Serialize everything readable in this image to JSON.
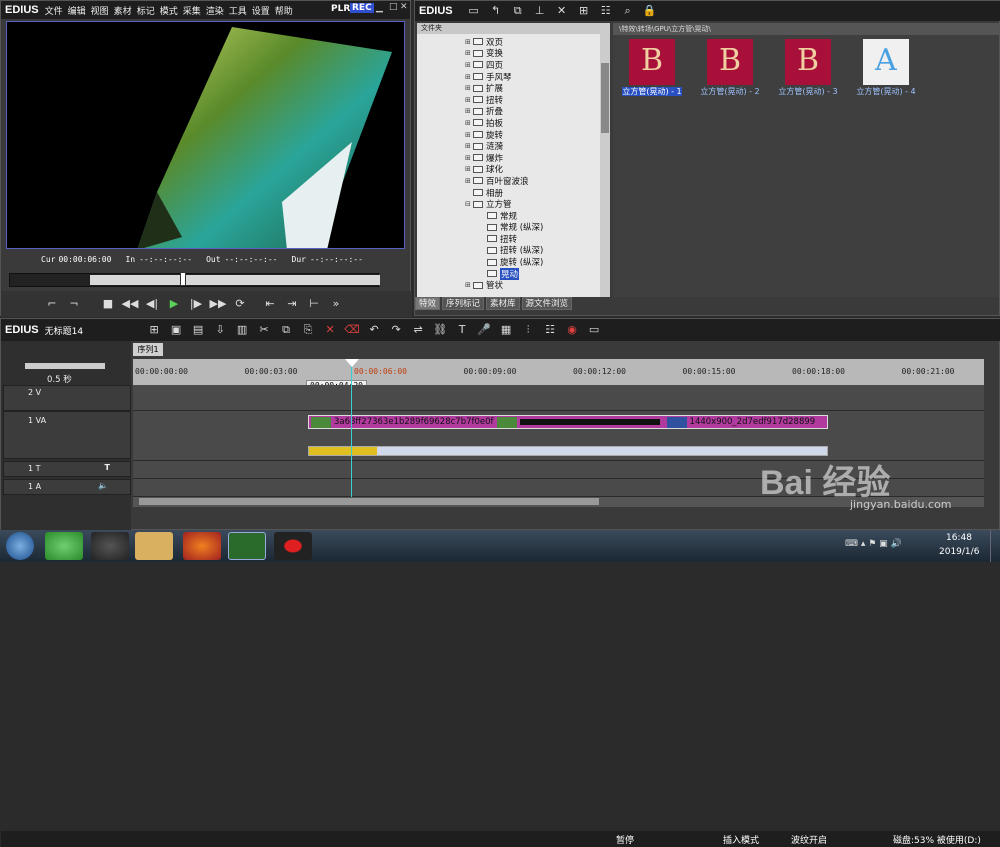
{
  "player": {
    "app_name": "EDIUS",
    "menu": [
      "文件",
      "编辑",
      "视图",
      "素材",
      "标记",
      "模式",
      "采集",
      "渲染",
      "工具",
      "设置",
      "帮助"
    ],
    "plr": "PLR",
    "rec": "REC",
    "cur_label": "Cur",
    "cur_value": "00:00:06:00",
    "in_label": "In",
    "in_value": "--:--:--:--",
    "out_label": "Out",
    "out_value": "--:--:--:--",
    "dur_label": "Dur",
    "dur_value": "--:--:--:--"
  },
  "bin": {
    "app_name": "EDIUS",
    "tree_header": "文件夹",
    "tree": [
      {
        "label": "双页",
        "type": "folder"
      },
      {
        "label": "变换",
        "type": "folder"
      },
      {
        "label": "四页",
        "type": "folder"
      },
      {
        "label": "手风琴",
        "type": "folder"
      },
      {
        "label": "扩展",
        "type": "folder"
      },
      {
        "label": "扭转",
        "type": "folder"
      },
      {
        "label": "折叠",
        "type": "folder"
      },
      {
        "label": "拍板",
        "type": "folder"
      },
      {
        "label": "旋转",
        "type": "folder"
      },
      {
        "label": "涟漪",
        "type": "folder"
      },
      {
        "label": "爆炸",
        "type": "folder"
      },
      {
        "label": "球化",
        "type": "folder"
      },
      {
        "label": "百叶窗波浪",
        "type": "folder"
      },
      {
        "label": "相册",
        "type": "leaf"
      },
      {
        "label": "立方管",
        "type": "open"
      },
      {
        "label": "常规",
        "type": "child"
      },
      {
        "label": "常规 (纵深)",
        "type": "child"
      },
      {
        "label": "扭转",
        "type": "child"
      },
      {
        "label": "扭转 (纵深)",
        "type": "child"
      },
      {
        "label": "旋转 (纵深)",
        "type": "child"
      },
      {
        "label": "晃动",
        "type": "child-sel"
      },
      {
        "label": "管状",
        "type": "folder"
      }
    ],
    "path": "\\特效\\转场\\GPU\\立方管\\晃动\\",
    "thumbs": [
      {
        "caption": "立方管(晃动) - 1",
        "letter": "B"
      },
      {
        "caption": "立方管(晃动) - 2",
        "letter": "B"
      },
      {
        "caption": "立方管(晃动) - 3",
        "letter": "B"
      },
      {
        "caption": "立方管(晃动) - 4",
        "letter": "A"
      }
    ],
    "tabs": [
      "特效",
      "序列标记",
      "素材库",
      "源文件浏览"
    ]
  },
  "timeline": {
    "app_name": "EDIUS",
    "project": "无标题14",
    "sequence_tab": "序列1",
    "zoom": "0.5 秒",
    "ruler": [
      "00:00:00:00",
      "00:00:03:00",
      "00:00:06:00",
      "00:00:09:00",
      "00:00:12:00",
      "00:00:15:00",
      "00:00:18:00",
      "00:00:21:00"
    ],
    "cursor_tooltip": "00:00:04:20",
    "tracks": [
      "2 V",
      "1 VA",
      "1 T",
      "1 A"
    ],
    "clip1_name": "3a68ff27363e1b289f69628c7b7f0e0f",
    "clip2_name": "1440x900_2d7edf917d28899",
    "status": [
      "暂停",
      "插入模式",
      "波纹开启",
      "磁盘:53% 被使用(D:)"
    ]
  },
  "taskbar": {
    "time": "16:48",
    "date": "2019/1/6"
  },
  "watermark": {
    "brand": "Bai 经验",
    "url": "jingyan.baidu.com"
  }
}
